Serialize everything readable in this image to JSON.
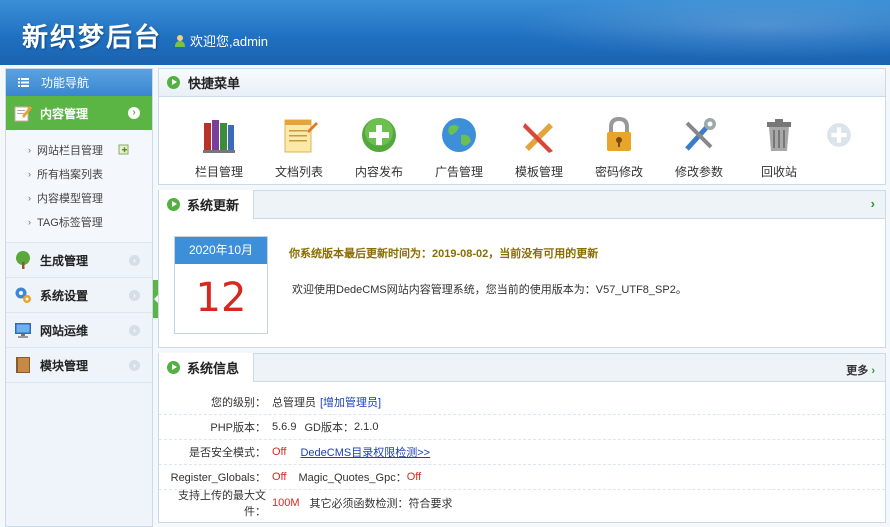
{
  "header": {
    "title": "新织梦后台",
    "welcome": "欢迎您,admin"
  },
  "sidebar": {
    "nav_title": "功能导航",
    "active_menu": "内容管理",
    "sub_items": [
      "网站栏目管理",
      "所有档案列表",
      "内容模型管理",
      "TAG标签管理"
    ],
    "menus": [
      {
        "label": "生成管理",
        "icon": "tree-icon"
      },
      {
        "label": "系统设置",
        "icon": "gears-icon"
      },
      {
        "label": "网站运维",
        "icon": "monitor-icon"
      },
      {
        "label": "模块管理",
        "icon": "book-icon"
      }
    ]
  },
  "quick_menu": {
    "title": "快捷菜单",
    "items": [
      "栏目管理",
      "文档列表",
      "内容发布",
      "广告管理",
      "模板管理",
      "密码修改",
      "修改参数",
      "回收站"
    ]
  },
  "update": {
    "title": "系统更新",
    "calendar_month": "2020年10月",
    "calendar_day": "12",
    "line1": "你系统版本最后更新时间为：2019-08-02，当前没有可用的更新",
    "line2": "欢迎使用DedeCMS网站内容管理系统，您当前的使用版本为：V57_UTF8_SP2。"
  },
  "info": {
    "title": "系统信息",
    "more": "更多",
    "level_label": "您的级别：",
    "level_value": "总管理员",
    "add_admin": "[增加管理员]",
    "php_label": "PHP版本：",
    "php_value": "5.6.9",
    "gd_label": "GD版本：",
    "gd_value": "2.1.0",
    "safe_label": "是否安全模式：",
    "safe_value": "Off",
    "perm_link": "DedeCMS目录权限检测>>",
    "rg_label": "Register_Globals：",
    "rg_value": "Off",
    "mq_label": "Magic_Quotes_Gpc：",
    "mq_value": "Off",
    "upload_label": "支持上传的最大文件：",
    "upload_value": "100M",
    "func_label": "其它必须函数检测：",
    "func_value": "符合要求"
  }
}
